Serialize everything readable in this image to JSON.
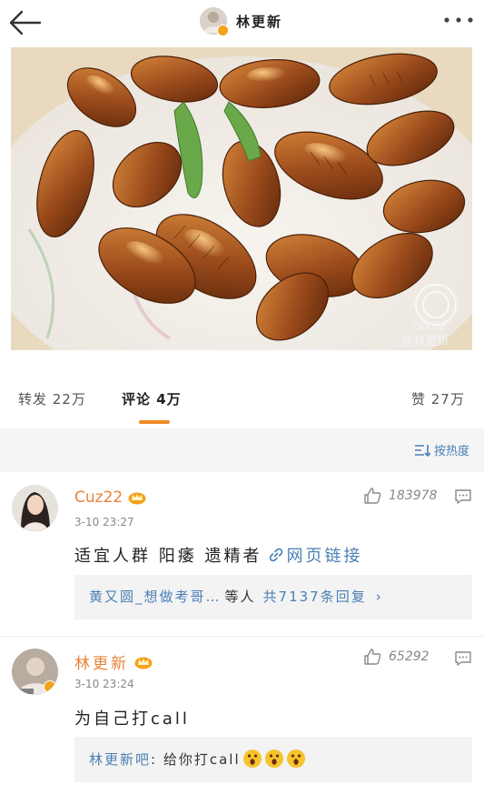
{
  "header": {
    "back_icon": "back-arrow-icon",
    "title": "林更新",
    "more_icon": "more-dots-icon"
  },
  "post": {
    "image_alt": "炒蚕蛹",
    "watermark": {
      "logo": "oodie",
      "handle": "@林更新"
    }
  },
  "stats": {
    "repost": "转发 22万",
    "comments": "评论 4万",
    "likes": "赞 27万"
  },
  "sort": {
    "label": "按热度",
    "icon": "sort-icon"
  },
  "comments": [
    {
      "name": "Cuz22",
      "badge": "crown-icon",
      "time": "3-10 23:27",
      "likes": "183978",
      "text": "适宜人群 阳痿 遗精者",
      "link_text": "网页链接",
      "replies_prefix": "黄又圆_想做考哥…",
      "replies_mid": "等人",
      "replies_count": "共7137条回复",
      "replies_arrow": "›"
    },
    {
      "name": "林更新",
      "badge": "crown-icon",
      "time": "3-10 23:24",
      "likes": "65292",
      "text": "为自己打call",
      "reply_author": "林更新吧",
      "reply_text": ": 给你打call"
    }
  ],
  "colors": {
    "accent": "#f08a24",
    "link": "#4a7fb5",
    "name": "#e9843b",
    "band": "#f5f5f5"
  }
}
